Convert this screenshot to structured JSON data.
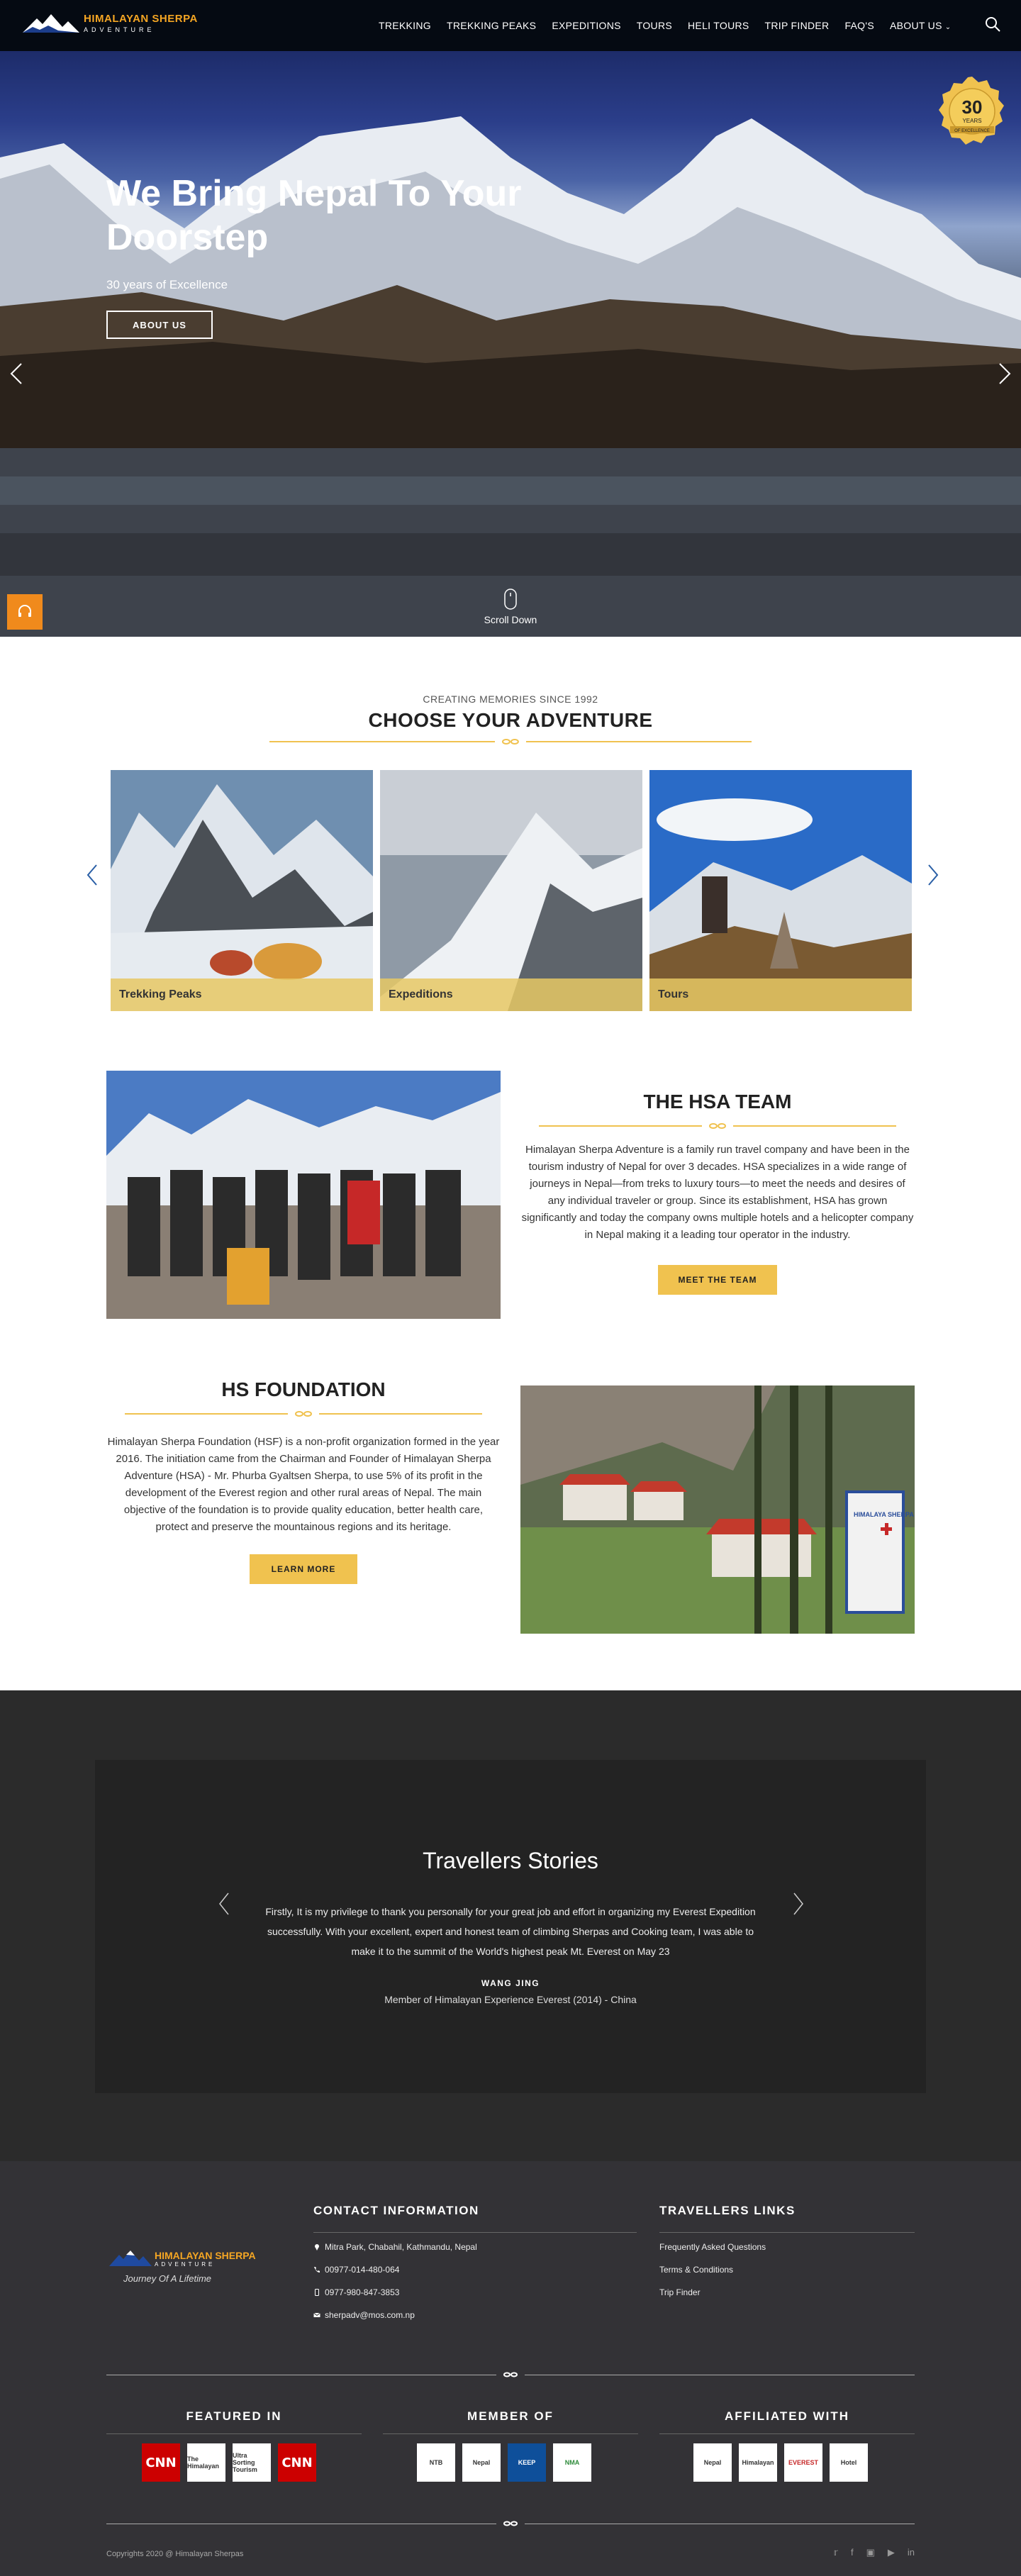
{
  "header": {
    "logo_title": "HIMALAYAN SHERPA",
    "logo_sub": "ADVENTURE",
    "nav": [
      {
        "label": "TREKKING"
      },
      {
        "label": "TREKKING PEAKS"
      },
      {
        "label": "EXPEDITIONS"
      },
      {
        "label": "TOURS"
      },
      {
        "label": "HELI TOURS"
      },
      {
        "label": "TRIP FINDER"
      },
      {
        "label": "FAQ'S"
      },
      {
        "label": "ABOUT US"
      }
    ]
  },
  "hero": {
    "title": "We Bring Nepal To Your Doorstep",
    "subtitle": "30 years of Excellence",
    "button": "ABOUT US",
    "badge_number": "30",
    "badge_years": "YEARS",
    "badge_text": "OF EXCELLENCE",
    "scroll": "Scroll Down"
  },
  "adventure": {
    "pretitle": "CREATING MEMORIES SINCE 1992",
    "title": "CHOOSE YOUR ADVENTURE",
    "cards": [
      {
        "label": "Trekking Peaks"
      },
      {
        "label": "Expeditions"
      },
      {
        "label": "Tours"
      }
    ]
  },
  "team": {
    "title": "THE HSA TEAM",
    "text": "Himalayan Sherpa Adventure is a family run travel company and have been in the tourism industry of Nepal for over 3 decades. HSA specializes in a wide range of journeys in Nepal—from treks to luxury tours—to meet the needs and desires of any individual traveler or group. Since its establishment, HSA has grown significantly and today the company owns multiple hotels and a helicopter company in Nepal making it a leading tour operator in the industry.",
    "button": "MEET THE TEAM"
  },
  "foundation": {
    "title": "HS FOUNDATION",
    "text": "Himalayan Sherpa Foundation (HSF) is a non-profit organization formed in the year 2016. The initiation came from the Chairman and Founder of Himalayan Sherpa Adventure (HSA) - Mr. Phurba Gyaltsen Sherpa, to use 5% of its profit in the development of the Everest region and other rural areas of Nepal. The main objective of the foundation is to provide quality education, better health care, protect and preserve the mountainous regions and its heritage.",
    "button": "LEARN MORE",
    "sign_text": "HIMALAYA SHERPA HOSPITAL"
  },
  "stories": {
    "title": "Travellers Stories",
    "quote": "Firstly, It is my privilege to thank you personally for your great job and effort in organizing my Everest Expedition successfully. With your excellent, expert and honest team of climbing Sherpas and Cooking team, I was able to make it to the summit of the World's highest peak Mt. Everest on May 23",
    "name": "WANG JING",
    "role": "Member of Himalayan Experience Everest (2014) - China"
  },
  "footer": {
    "logo_title": "HIMALAYAN SHERPA",
    "logo_sub": "ADVENTURE",
    "tagline": "Journey Of A Lifetime",
    "contact_head": "CONTACT INFORMATION",
    "address": "Mitra Park, Chabahil, Kathmandu, Nepal",
    "phone1": "00977-014-480-064",
    "phone2": "0977-980-847-3853",
    "email": "sherpadv@mos.com.np",
    "links_head": "TRAVELLERS LINKS",
    "links": [
      "Frequently Asked Questions",
      "Terms & Conditions",
      "Trip Finder"
    ],
    "featured_head": "FEATURED IN",
    "featured": [
      "CNN",
      "The Himalayan",
      "Ultra Sorting Tourism",
      "CNN"
    ],
    "member_head": "MEMBER OF",
    "members": [
      "NTB",
      "Nepal",
      "KEEP",
      "NMA"
    ],
    "affiliated_head": "AFFILIATED WITH",
    "affiliated": [
      "Nepal",
      "Himalayan",
      "EVEREST",
      "Hotel"
    ],
    "copyright": "Copyrights 2020 @ Himalayan Sherpas",
    "social": [
      "twitter-icon",
      "facebook-icon",
      "instagram-icon",
      "youtube-icon",
      "linkedin-icon"
    ]
  },
  "colors": {
    "accent": "#f0c24f",
    "brand_orange": "#f5a623",
    "dark": "#2b2b2b"
  }
}
